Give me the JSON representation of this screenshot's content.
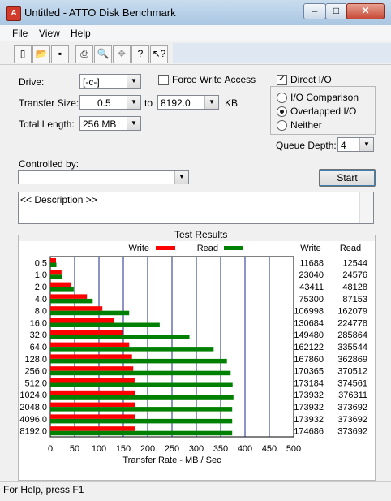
{
  "window": {
    "title": "Untitled - ATTO Disk Benchmark",
    "min": "–",
    "max": "□",
    "close": "✕"
  },
  "menu": [
    "File",
    "View",
    "Help"
  ],
  "toolbar": {
    "new": "new-icon",
    "open": "open-icon",
    "save": "save-icon",
    "print": "print-icon",
    "preview": "print-preview-icon",
    "move": "move-icon",
    "help": "help-icon",
    "context_help": "context-help-icon"
  },
  "form": {
    "drive_label": "Drive:",
    "drive_value": "[-c-]",
    "transfer_label": "Transfer Size:",
    "transfer_from": "0.5",
    "to_label": "to",
    "transfer_to": "8192.0",
    "kb_label": "KB",
    "length_label": "Total Length:",
    "length_value": "256 MB",
    "force_write_label": "Force Write Access",
    "force_write_checked": false,
    "direct_io_label": "Direct I/O",
    "direct_io_checked": true,
    "io_comparison_label": "I/O Comparison",
    "overlapped_label": "Overlapped I/O",
    "neither_label": "Neither",
    "selected_mode": "Overlapped I/O",
    "queue_label": "Queue Depth:",
    "queue_value": "4",
    "controlled_label": "Controlled by:",
    "controlled_value": "",
    "start_label": "Start",
    "description": "<< Description >>"
  },
  "results_title": "Test Results",
  "status": "For Help, press F1",
  "chart_data": {
    "type": "bar",
    "orientation": "horizontal",
    "categories": [
      "0.5",
      "1.0",
      "2.0",
      "4.0",
      "8.0",
      "16.0",
      "32.0",
      "64.0",
      "128.0",
      "256.0",
      "512.0",
      "1024.0",
      "2048.0",
      "4096.0",
      "8192.0"
    ],
    "series": [
      {
        "name": "Write",
        "color": "#ff0000",
        "values": [
          11688,
          23040,
          43411,
          75300,
          106998,
          130684,
          149480,
          162122,
          167860,
          170365,
          173184,
          173932,
          173932,
          173932,
          174686
        ]
      },
      {
        "name": "Read",
        "color": "#008000",
        "values": [
          12544,
          24576,
          48128,
          87153,
          162079,
          224778,
          285864,
          335544,
          362869,
          370512,
          374561,
          376311,
          373692,
          373692,
          373692
        ]
      }
    ],
    "column_headers": [
      "Write",
      "Read"
    ],
    "xlabel": "Transfer Rate - MB / Sec",
    "xticks": [
      "0",
      "50",
      "100",
      "150",
      "200",
      "250",
      "300",
      "350",
      "400",
      "450",
      "500"
    ],
    "xlim": [
      0,
      500
    ],
    "grid": true,
    "legend": "top"
  }
}
